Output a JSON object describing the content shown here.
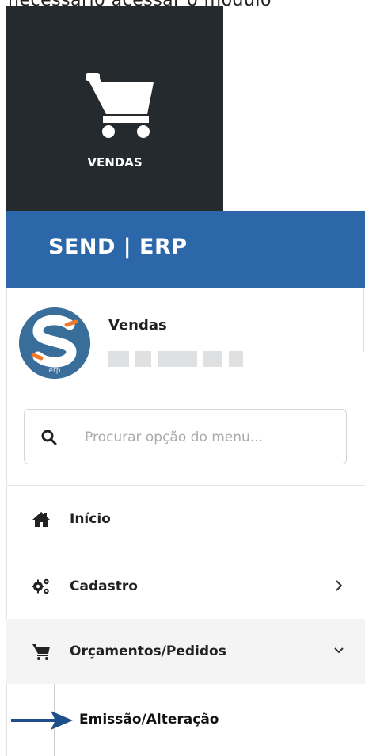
{
  "top_text": "necessário acessar o módulo",
  "tile": {
    "label": "VENDAS",
    "icon": "shopping-cart-icon"
  },
  "header": {
    "title": "SEND | ERP"
  },
  "user": {
    "name": "Vendas",
    "avatar_text": "erp"
  },
  "search": {
    "placeholder": "Procurar opção do menu..."
  },
  "menu": [
    {
      "label": "Início",
      "icon": "home-icon"
    },
    {
      "label": "Cadastro",
      "icon": "cogs-icon",
      "chevron": "chevron-right-icon"
    },
    {
      "label": "Orçamentos/Pedidos",
      "icon": "shopping-cart-icon",
      "chevron": "chevron-down-icon",
      "expanded": true
    }
  ],
  "submenu": [
    {
      "label": "Emissão/Alteração"
    }
  ],
  "colors": {
    "tile_bg": "#242a2d",
    "brand": "#2c68a9",
    "arrow": "#1f4f8a",
    "accent_orange": "#f07a2a"
  }
}
